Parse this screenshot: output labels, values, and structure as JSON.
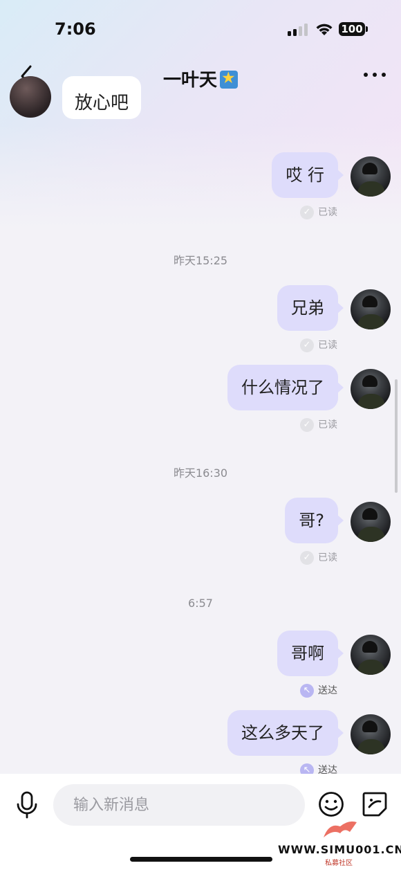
{
  "status_bar": {
    "time": "7:06",
    "battery": "100"
  },
  "header": {
    "title": "一叶天",
    "title_emoji": "star-emoji"
  },
  "previous_message": {
    "text": "放心吧"
  },
  "messages": [
    {
      "text": "哎 行",
      "receipt": "已读",
      "status": "read"
    },
    {
      "timestamp": "昨天15:25"
    },
    {
      "text": "兄弟",
      "receipt": "已读",
      "status": "read"
    },
    {
      "text": "什么情况了",
      "receipt": "已读",
      "status": "read"
    },
    {
      "timestamp": "昨天16:30"
    },
    {
      "text": "哥?",
      "receipt": "已读",
      "status": "read"
    },
    {
      "timestamp": "6:57"
    },
    {
      "text": "哥啊",
      "receipt": "送达",
      "status": "delivered"
    },
    {
      "text": "这么多天了",
      "receipt": "送达",
      "status": "delivered"
    }
  ],
  "input": {
    "placeholder": "输入新消息"
  },
  "watermark": {
    "text": "WWW.SIMU001.CN",
    "subtext": "私募社区"
  },
  "colors": {
    "bubble": "#dedcfb",
    "read_dot": "#e2e2e6",
    "delivered_dot": "#b9b6f2"
  }
}
